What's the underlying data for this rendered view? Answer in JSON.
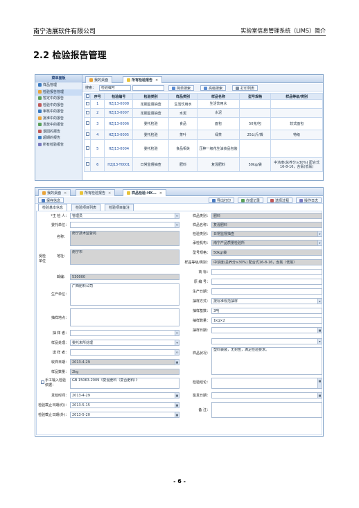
{
  "header": {
    "company": "南宁浩展软件有限公司",
    "doc_title": "实验室信息管理系统（LIMS）简介"
  },
  "section_title": "2.2 检验报告管理",
  "page_number": "- 6 -",
  "shot1": {
    "sidebar_title": "菜单面板",
    "sidebar": [
      "样品管理",
      "检验报告管理",
      "暂定中的报告",
      "检验中的报告",
      "审核中的报告",
      "批准中的报告",
      "发放中的报告",
      "退回的报告",
      "超期的报告",
      "所有检验报告"
    ],
    "tabs": [
      "我的桌面",
      "所有检验报告"
    ],
    "search": {
      "label": "搜索：",
      "field": "检验编号",
      "buttons": [
        "简单搜索",
        "高级搜索",
        "打印列表"
      ]
    },
    "columns": [
      "序号",
      "检验编号",
      "检验类别",
      "样品类别",
      "样品名称",
      "型号规格",
      "样品等级/类别"
    ],
    "rows": [
      [
        "1",
        "HZJ13-0008",
        "定期监督抽查",
        "生活饮用水",
        "生活饮用水",
        "",
        ""
      ],
      [
        "2",
        "HZJ13-0007",
        "定期监督抽查",
        "水泥",
        "水泥",
        "",
        ""
      ],
      [
        "3",
        "HZJ13-0006",
        "委托检验",
        "食品",
        "面包",
        "50克/包",
        "软式面包"
      ],
      [
        "4",
        "HZJ13-0005",
        "委托检验",
        "茶叶",
        "绿茶",
        "25公斤/袋",
        "特级"
      ],
      [
        "5",
        "HZJ13-0004",
        "委托检验",
        "食品相关",
        "压榨一级花生油食品包装",
        ""
      ],
      [
        "6",
        "HZJ13-T0001",
        "日常监督抽查",
        "肥料",
        "复混肥料",
        "50kg/袋",
        "中浓度(总养分≥30%) 配合式16-8-16，含氯(低氯)"
      ]
    ]
  },
  "shot2": {
    "tabs": [
      "我的桌面",
      "所有检验报告",
      "样品检验-HX..."
    ],
    "toolbar_left": "保存信息",
    "toolbar_right": [
      "导出打印",
      "办理记录",
      "选择过程",
      "操作日志"
    ],
    "form_tabs": [
      "检验基本信息",
      "检验项目列表",
      "检验项目备注"
    ],
    "left": {
      "inspector_label": "*主 检 人：",
      "inspector": "管理员",
      "commission_unit_label": "委托单位：",
      "group_label": "受检单位",
      "name_label": "名称：",
      "name": "南宁技术监督局",
      "address_label": "地址：",
      "address": "南宁市",
      "postcode_label": "邮编：",
      "postcode": "530000",
      "producer_label": "生产单位：",
      "producer": "广西肥料公司",
      "sampling_place_label": "抽样地点：",
      "sampler_label": "抽 样 者：",
      "sample_handling_label": "样品处理：",
      "sample_handling": "委托未所处理",
      "sender_label": "送 样 者：",
      "receive_date_label": "收样日期：",
      "receive_date": "2013-4-29",
      "sample_qty_label": "样品数量：",
      "sample_qty": "2kg",
      "manual_label": "手工输入检验依据：",
      "basis": "GB 15063-2009《复混肥料（复合肥料）》",
      "issue_date_label": "发检时间：",
      "issue_date": "2013-4-29",
      "deadline_label": "检验截止日期(约)：",
      "deadline": "2013-5-15",
      "deadline2_label": "检验截止日期(外)：",
      "deadline2": "2013-5-20"
    },
    "right": {
      "sample_category_label": "样品类别：",
      "sample_category": "肥料",
      "sample_name_label": "样品名称：",
      "sample_name": "复混肥料",
      "test_type_label": "检验类别：",
      "test_type": "日常监督抽查",
      "test_org_label": "承检机构：",
      "test_org": "南宁产品质量检验所",
      "spec_label": "型号规格：",
      "spec": "50kg/袋",
      "grade_label": "样品等级/类别：",
      "grade": "中浓度(总养分≥30%) 配合式16-8-16，含氯（低氯）",
      "trademark_label": "商 标：",
      "batch_label": "原 编 号：",
      "prod_date_label": "生产日期：",
      "sampling_method_label": "抽样方式：",
      "sampling_method": "按标准规范抽样",
      "sampling_base_label": "抽样基数：",
      "sampling_base": "3吨",
      "sampling_qty_label": "抽样数量：",
      "sampling_qty": "1kg×2",
      "sampling_date_label": "抽样日期：",
      "sample_desc_label": "样品状况：",
      "sample_desc": "塑料袋装，无封签，满足检验要求。",
      "conclusion_label": "检验结论：",
      "approve_date_label": "签发日期：",
      "remark_label": "备 注："
    }
  }
}
